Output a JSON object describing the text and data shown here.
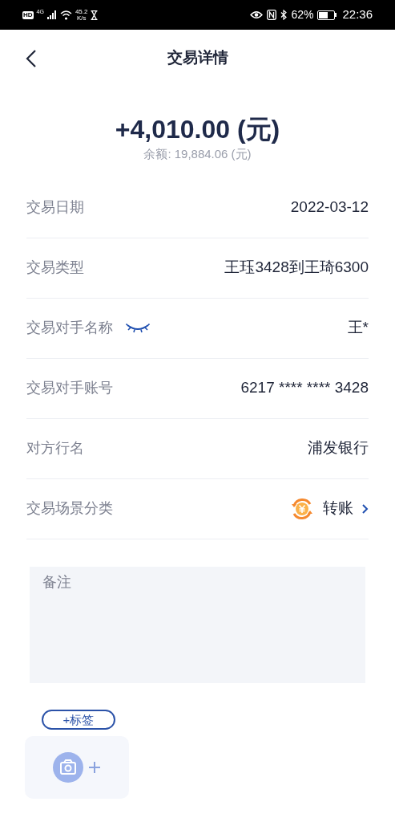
{
  "status_bar": {
    "hd": "HD",
    "network": "4G",
    "speed": "45.2",
    "speed_unit": "K/s",
    "battery": "62%",
    "time": "22:36"
  },
  "header": {
    "title": "交易详情"
  },
  "amount": "+4,010.00 (元)",
  "balance": "余额: 19,884.06 (元)",
  "rows": [
    {
      "kind": "text",
      "label": "交易日期",
      "value": "2022-03-12"
    },
    {
      "kind": "text",
      "label": "交易类型",
      "value": "王珏3428到王琦6300"
    },
    {
      "kind": "masked",
      "label": "交易对手名称",
      "value": "王*"
    },
    {
      "kind": "text",
      "label": "交易对手账号",
      "value": "6217 **** **** 3428"
    },
    {
      "kind": "text",
      "label": "对方行名",
      "value": "浦发银行"
    },
    {
      "kind": "category",
      "label": "交易场景分类",
      "value": "转账"
    }
  ],
  "remark": {
    "placeholder": "备注"
  },
  "tag_button": "+标签"
}
